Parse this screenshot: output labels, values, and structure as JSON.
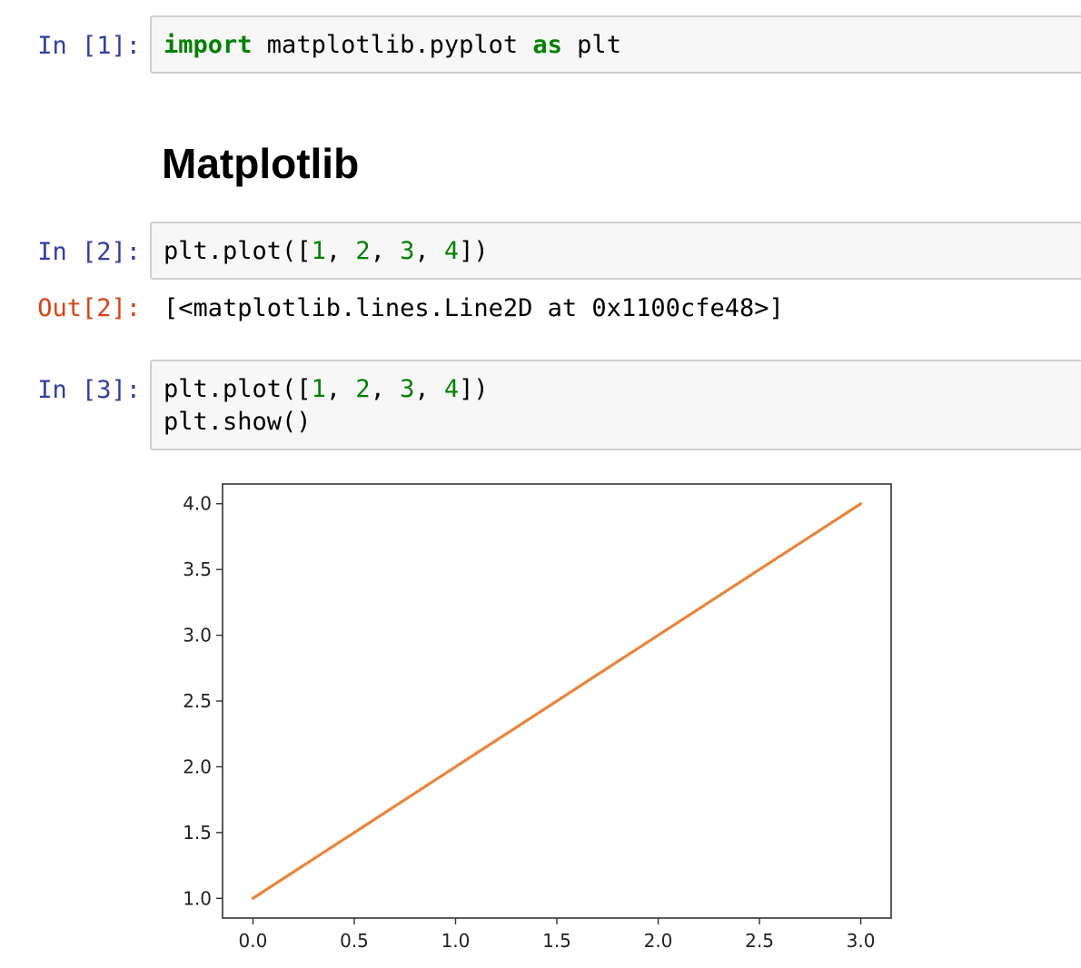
{
  "cells": [
    {
      "prompt": "In [1]:",
      "code_lines": [
        [
          {
            "t": "import",
            "c": "kw"
          },
          {
            "t": " matplotlib.pyplot ",
            "c": ""
          },
          {
            "t": "as",
            "c": "kw"
          },
          {
            "t": " plt",
            "c": ""
          }
        ]
      ]
    },
    {
      "prompt": "In [2]:",
      "code_lines": [
        [
          {
            "t": "plt.plot([",
            "c": ""
          },
          {
            "t": "1",
            "c": "num"
          },
          {
            "t": ", ",
            "c": ""
          },
          {
            "t": "2",
            "c": "num"
          },
          {
            "t": ", ",
            "c": ""
          },
          {
            "t": "3",
            "c": "num"
          },
          {
            "t": ", ",
            "c": ""
          },
          {
            "t": "4",
            "c": "num"
          },
          {
            "t": "])",
            "c": ""
          }
        ]
      ],
      "output_prompt": "Out[2]:",
      "output_text": "[<matplotlib.lines.Line2D at 0x1100cfe48>]"
    },
    {
      "prompt": "In [3]:",
      "code_lines": [
        [
          {
            "t": "plt.plot([",
            "c": ""
          },
          {
            "t": "1",
            "c": "num"
          },
          {
            "t": ", ",
            "c": ""
          },
          {
            "t": "2",
            "c": "num"
          },
          {
            "t": ", ",
            "c": ""
          },
          {
            "t": "3",
            "c": "num"
          },
          {
            "t": ", ",
            "c": ""
          },
          {
            "t": "4",
            "c": "num"
          },
          {
            "t": "])",
            "c": ""
          }
        ],
        [
          {
            "t": "plt.show()",
            "c": ""
          }
        ]
      ]
    }
  ],
  "markdown_heading": "Matplotlib",
  "chart_data": {
    "type": "line",
    "x": [
      0,
      1,
      2,
      3
    ],
    "series": [
      {
        "values": [
          1,
          2,
          3,
          4
        ],
        "color": "#e8853d"
      }
    ],
    "xlim": [
      -0.15,
      3.15
    ],
    "ylim": [
      0.85,
      4.15
    ],
    "xticks": [
      0.0,
      0.5,
      1.0,
      1.5,
      2.0,
      2.5,
      3.0
    ],
    "xtick_labels": [
      "0.0",
      "0.5",
      "1.0",
      "1.5",
      "2.0",
      "2.5",
      "3.0"
    ],
    "yticks": [
      1.0,
      1.5,
      2.0,
      2.5,
      3.0,
      3.5,
      4.0
    ],
    "ytick_labels": [
      "1.0",
      "1.5",
      "2.0",
      "2.5",
      "3.0",
      "3.5",
      "4.0"
    ],
    "title": "",
    "xlabel": "",
    "ylabel": "",
    "grid": false
  }
}
